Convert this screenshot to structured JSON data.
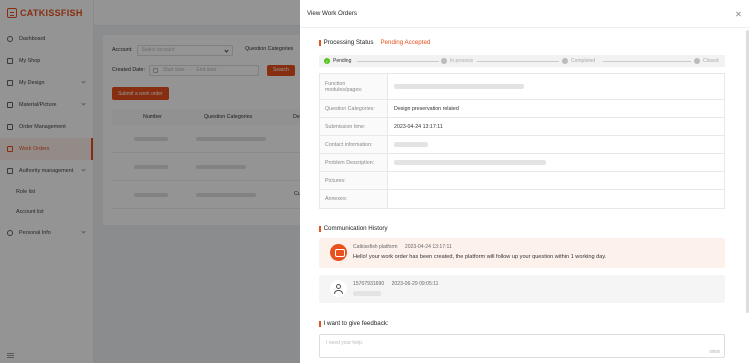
{
  "brand": {
    "name": "CATKISSFISH",
    "accent": "#e8501e"
  },
  "sidebar": {
    "items": [
      {
        "label": "Dashboard",
        "icon": "dashboard-icon"
      },
      {
        "label": "My Shop",
        "icon": "shop-icon"
      },
      {
        "label": "My Design",
        "icon": "design-icon"
      },
      {
        "label": "Material/Picture",
        "icon": "picture-icon"
      },
      {
        "label": "Order Management",
        "icon": "order-icon"
      },
      {
        "label": "Work Orders",
        "icon": "work-order-icon",
        "active": true
      },
      {
        "label": "Authority management",
        "icon": "authority-icon"
      },
      {
        "label": "Role list"
      },
      {
        "label": "Account list"
      },
      {
        "label": "Personal Info",
        "icon": "person-icon"
      }
    ]
  },
  "list_page": {
    "account_label": "Account:",
    "account_placeholder": "Select account",
    "question_categories_label": "Question Categories",
    "created_date_label": "Created Date:",
    "start_date_placeholder": "Start date",
    "end_date_placeholder": "End date",
    "search_button": "Search",
    "submit_button": "Submit a work order",
    "columns": [
      "Number",
      "Question Categories",
      "De"
    ],
    "row3_partial": "Cu"
  },
  "drawer": {
    "title": "View Work Orders",
    "processing_status_label": "Processing Status",
    "processing_status_value": "Pending Accepted",
    "steps": [
      {
        "label": "Pending",
        "done": true
      },
      {
        "label": "In process",
        "done": false
      },
      {
        "label": "Completed",
        "done": false
      },
      {
        "label": "Closed",
        "done": false
      }
    ],
    "details": [
      {
        "key": "Function modules/pages:",
        "value": ""
      },
      {
        "key": "Question Categories:",
        "value": "Design preservation related"
      },
      {
        "key": "Submission time:",
        "value": "2023-04-24 13:17:11"
      },
      {
        "key": "Contact information:",
        "value": ""
      },
      {
        "key": "Problem Description:",
        "value": ""
      },
      {
        "key": "Pictures:",
        "value": ""
      },
      {
        "key": "Annexes:",
        "value": ""
      }
    ],
    "communication_title": "Communication History",
    "messages": [
      {
        "sender": "Catkissfish platform",
        "time": "2023-04-24 13:17:11",
        "text": "Hello! your work order has been created, the platform will follow up your question within 1 working day."
      },
      {
        "sender": "15707931690",
        "time": "2023-06-29 09:05:11",
        "text": ""
      }
    ],
    "feedback_title": "I want to give feedback:",
    "feedback_placeholder": "I need your help.",
    "feedback_count": "0/500"
  }
}
